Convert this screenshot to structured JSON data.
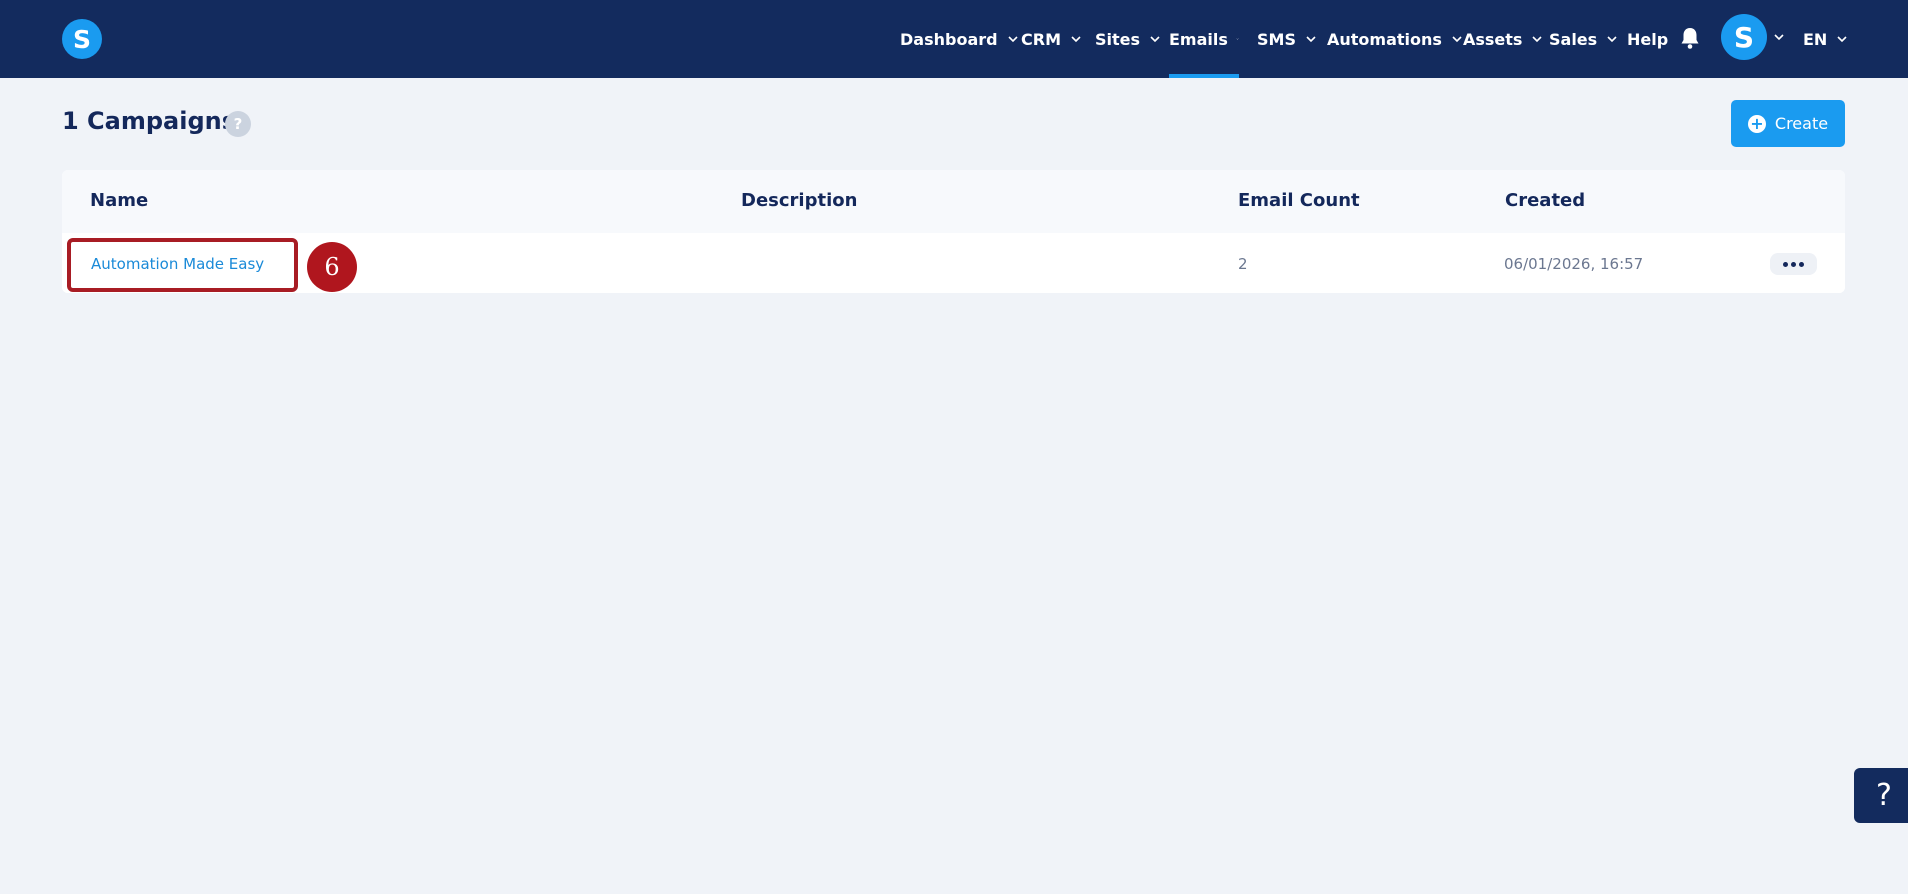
{
  "brand": {
    "logo_letter": "S"
  },
  "nav": {
    "dashboard": "Dashboard",
    "crm": "CRM",
    "sites": "Sites",
    "emails": "Emails",
    "sms": "SMS",
    "automations": "Automations",
    "assets": "Assets",
    "sales": "Sales",
    "help": "Help",
    "language": "EN",
    "active": "emails"
  },
  "user": {
    "avatar_letter": "S"
  },
  "page": {
    "title": "1 Campaigns",
    "help_symbol": "?",
    "create_label": "Create",
    "create_symbol": "+"
  },
  "table": {
    "columns": [
      "Name",
      "Description",
      "Email Count",
      "Created"
    ],
    "rows": [
      {
        "name": "Automation Made Easy",
        "description": "",
        "email_count": "2",
        "created": "06/01/2026, 16:57"
      }
    ]
  },
  "annotation": {
    "step_number": "6"
  },
  "support": {
    "symbol": "?"
  },
  "colors": {
    "topbar": "#132b5e",
    "accent": "#1a9bf0",
    "highlight": "#a81c24",
    "background": "#f0f3f8"
  },
  "icons": {
    "bell": "bell-icon",
    "chevron": "chevron-down-icon",
    "more": "more-horizontal-icon",
    "plus": "plus-circle-icon",
    "question": "question-icon"
  }
}
